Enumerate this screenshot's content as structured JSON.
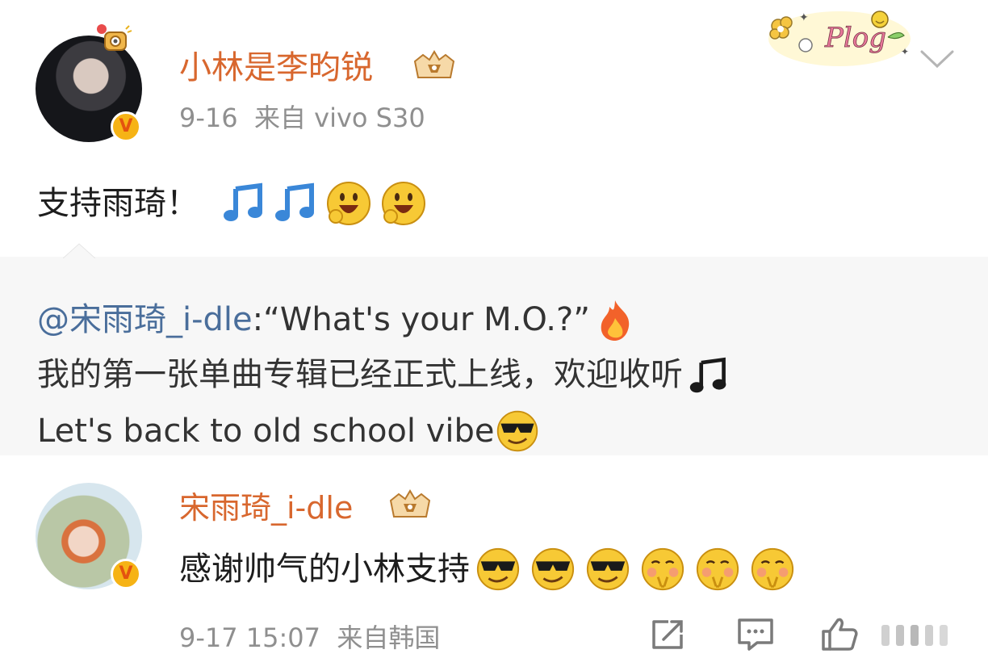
{
  "post": {
    "author": "小林是李昀锐",
    "date": "9-16",
    "source": "来自 vivo S30",
    "text": "支持雨琦！",
    "emojis": [
      "music-note-blue",
      "music-note-blue",
      "grinning-face",
      "grinning-face"
    ]
  },
  "quote": {
    "mention": "@宋雨琦_i-dle",
    "line1_rest": ":“What's your M.O.?”",
    "line2": "我的第一张单曲专辑已经正式上线，欢迎收听",
    "line3": "Let's back to old school vibe"
  },
  "reply": {
    "author": "宋雨琦_i-dle",
    "text": "感谢帅气的小林支持",
    "date": "9-17 15:07",
    "source": "来自韩国",
    "emojis": [
      "sunglasses-face",
      "sunglasses-face",
      "sunglasses-face",
      "pleading-face",
      "pleading-face",
      "pleading-face"
    ]
  },
  "badges": {
    "verified": "V",
    "sticker": "Plog"
  },
  "colors": {
    "username": "#d8672e",
    "mention": "#4a6e9b",
    "meta": "#8f8f8f",
    "verified_badge": "#f6b315"
  }
}
